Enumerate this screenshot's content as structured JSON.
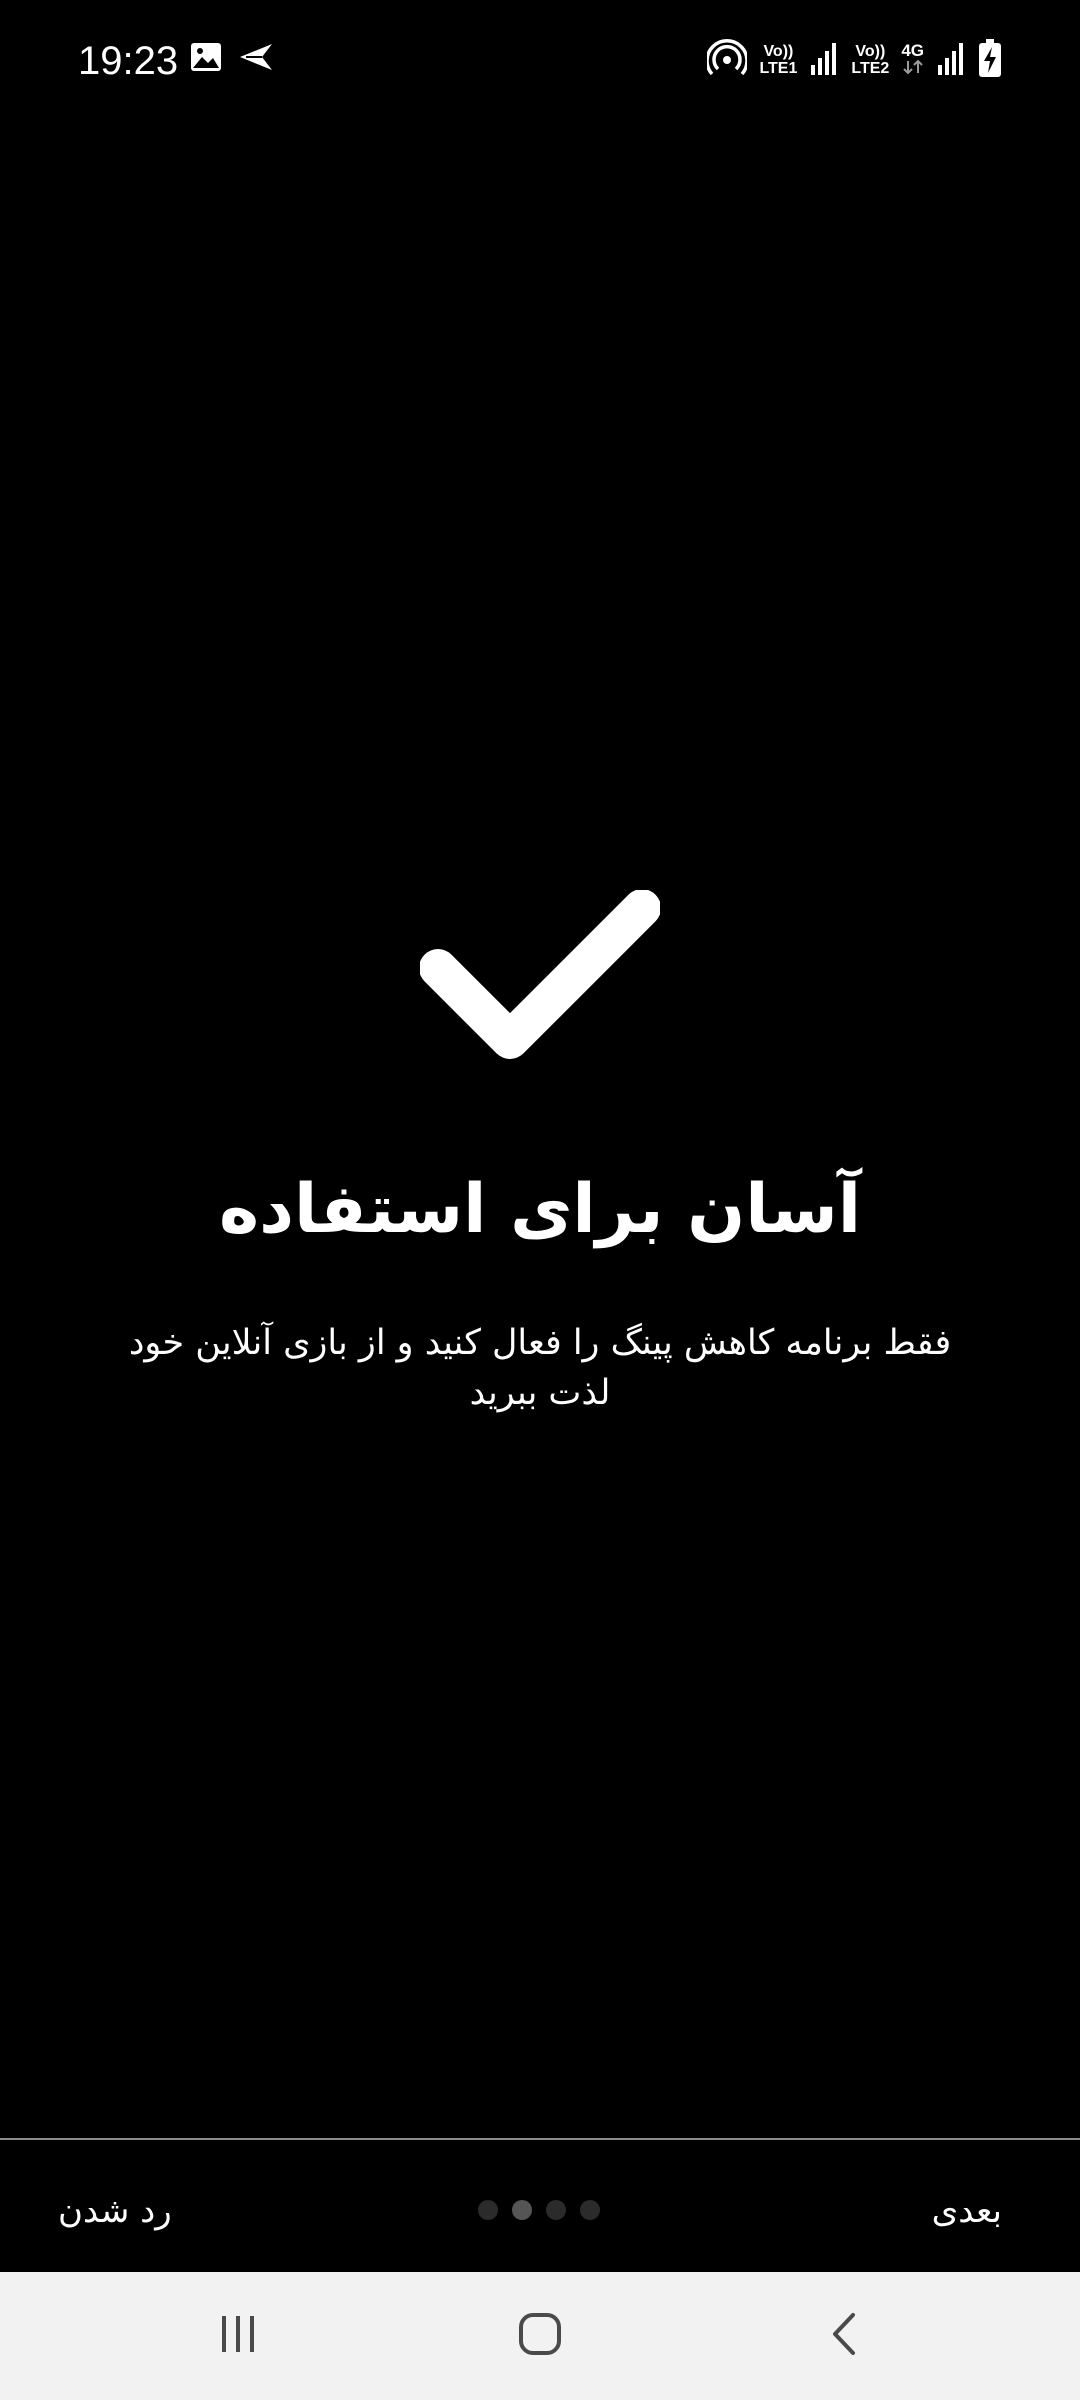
{
  "status_bar": {
    "time": "19:23",
    "left_icons": [
      "image-icon",
      "send-icon"
    ],
    "right_icons": [
      "hotspot-icon",
      "volte-lte1-icon",
      "signal-icon",
      "volte-lte2-icon",
      "network-4g-icon",
      "signal-icon",
      "battery-charging-icon"
    ],
    "sim1_top": "Vo))",
    "sim1_bottom": "LTE1",
    "sim2_top": "Vo))",
    "sim2_bottom": "LTE2",
    "network_type": "4G"
  },
  "main": {
    "icon": "checkmark-icon",
    "title": "آسان برای استفاده",
    "subtitle": "فقط برنامه کاهش پینگ را فعال کنید و از بازی آنلاین خود لذت ببرید"
  },
  "onboarding": {
    "skip_label": "رد شدن",
    "next_label": "بعدی",
    "page_count": 4,
    "active_index": 1
  },
  "nav_bar": {
    "buttons": [
      "recent-apps-icon",
      "home-icon",
      "back-icon"
    ]
  },
  "colors": {
    "background": "#000000",
    "text": "#ffffff",
    "divider": "#8a8a8a",
    "nav_background": "#f2f2f2"
  }
}
